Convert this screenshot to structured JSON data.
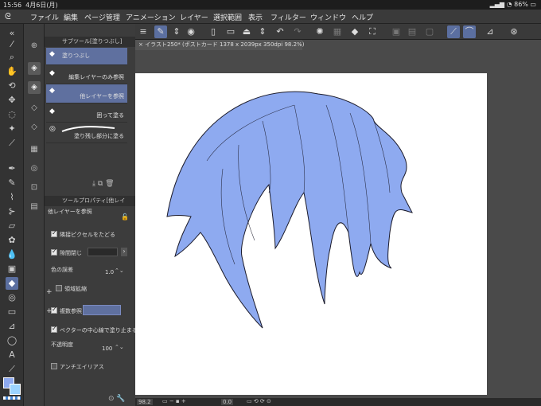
{
  "status": {
    "time": "15:56",
    "date": "4月6日(月)",
    "battery": "86%"
  },
  "menu": [
    "ファイル",
    "編集",
    "ページ管理",
    "アニメーション",
    "レイヤー",
    "選択範囲",
    "表示",
    "フィルター",
    "ウィンドウ",
    "ヘルプ"
  ],
  "subtool_panel": {
    "title": "サブツール[塗りつぶし]",
    "items": [
      {
        "label": "塗りつぶし",
        "selected": false
      },
      {
        "label": "編集レイヤーのみ参照",
        "selected": false
      },
      {
        "label": "他レイヤーを参照",
        "selected": true
      },
      {
        "label": "囲って塗る",
        "selected": false
      },
      {
        "label": "塗り残し部分に塗る",
        "selected": false
      }
    ]
  },
  "tool_property": {
    "title": "ツールプロパティ[他レイ",
    "subtitle": "他レイヤーを参照",
    "follow_adjacent": "隣接ピクセルをたどる",
    "close_gap": "隙間閉じ",
    "color_margin_label": "色の誤差",
    "color_margin_value": "1.0",
    "area_scaling": "領域拡縮",
    "multi_ref": "複数参照",
    "vector_stop": "ベクターの中心線で塗り止まる",
    "opacity_label": "不透明度",
    "opacity_value": "100",
    "antialias": "アンチエイリアス"
  },
  "document": {
    "tab_title": "イラスト250* (ポストカード 1378 x 2039px 350dpi 98.2%)"
  },
  "bottom": {
    "zoom": "98.2",
    "angle": "0.0"
  },
  "colors": {
    "accent": "#5f709f",
    "hair": "#8eaaf0"
  }
}
